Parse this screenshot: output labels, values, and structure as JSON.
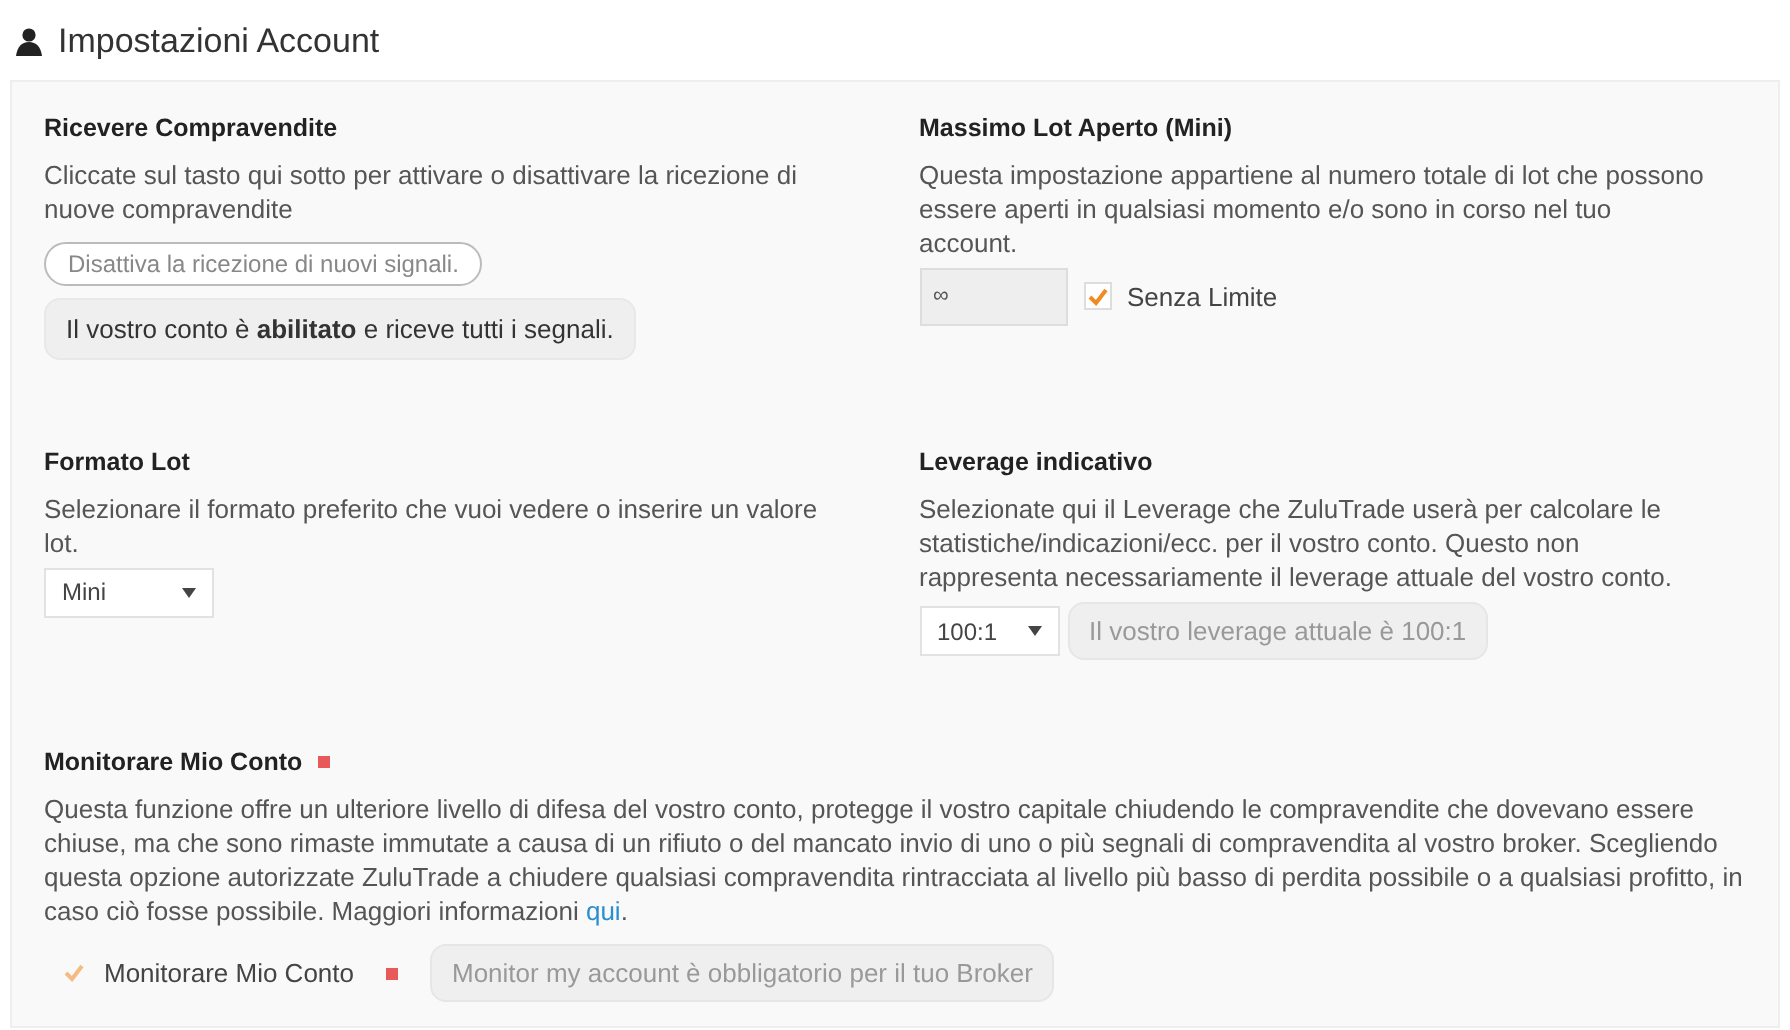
{
  "title": "Impostazioni Account",
  "sections": [
    {
      "kind": "toggle",
      "heading": "Ricevere Compravendite",
      "description": "Cliccate sul tasto qui sotto per attivare o disattivare la ricezione di nuove compravendite",
      "button": {
        "label": "Disattiva la ricezione di nuovi signali."
      },
      "status": "Il vostro conto è **abilitato** e riceve tutti i segnali."
    },
    {
      "kind": "limit",
      "heading": "Massimo Lot Aperto (Mini)",
      "description": "Questa impostazione appartiene al numero totale di lot che possono essere aperti in qualsiasi momento e/o sono in corso nel tuo account.",
      "field": {
        "value": "∞"
      },
      "checkbox": {
        "label": "Senza Limite",
        "checked": true,
        "disabled": false
      }
    },
    {
      "kind": "select",
      "heading": "Formato Lot",
      "description": "Selezionare il formato preferito che vuoi vedere o inserire un valore lot.",
      "select": {
        "value": "Mini"
      }
    },
    {
      "kind": "select",
      "heading": "Leverage indicativo",
      "description": "Selezionate qui il Leverage che ZuluTrade userà per calcolare le statistiche/indicazioni/ecc. per il vostro conto. Questo non rappresenta necessariamente il leverage attuale del vostro conto.",
      "select": {
        "value": "100:1"
      },
      "note": "Il vostro leverage attuale è 100:1"
    },
    {
      "kind": "monitor",
      "heading": "Monitorare Mio Conto",
      "required": true,
      "description": "Questa funzione offre un ulteriore livello di difesa del vostro conto, protegge il vostro capitale chiudendo le compravendite che dovevano essere chiuse, ma che sono rimaste immutate a causa di un rifiuto o del mancato invio di uno o più segnali di compravendita al vostro broker. Scegliendo questa opzione autorizzate ZuluTrade a chiudere qualsiasi compravendita rintracciata al livello più basso di perdita possibile o a qualsiasi profitto, in caso ciò fosse possibile. Maggiori informazioni ",
      "link": "qui",
      "description_end": ".",
      "checkbox": {
        "label": "Monitorare Mio Conto",
        "checked": true,
        "disabled": true,
        "required": true
      },
      "note": "Monitor my account è obbligatorio per il tuo Broker"
    }
  ]
}
